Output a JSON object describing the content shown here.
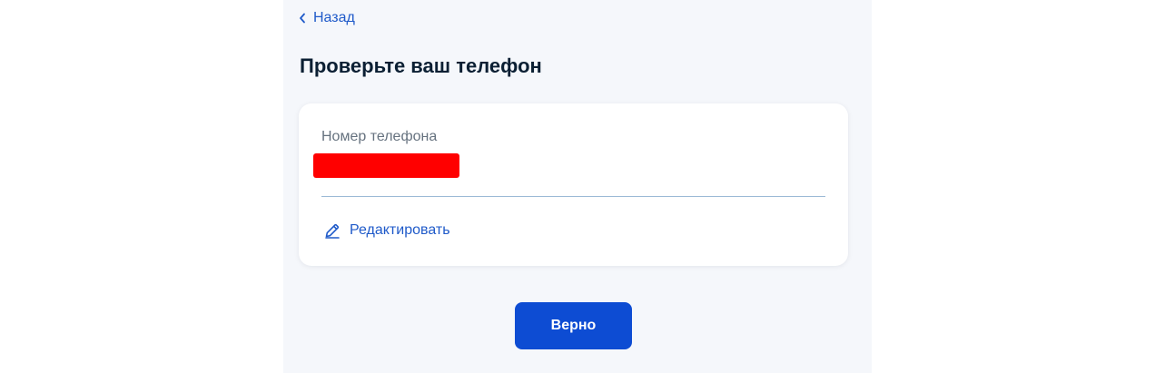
{
  "back_link": {
    "label": "Назад",
    "icon": "chevron-left-icon"
  },
  "page": {
    "title": "Проверьте ваш телефон"
  },
  "phone_card": {
    "field_label": "Номер телефона",
    "value_state": "redacted",
    "redaction_color": "#ff0000",
    "edit_label": "Редактировать",
    "edit_icon": "pencil-icon"
  },
  "actions": {
    "confirm_label": "Верно"
  },
  "colors": {
    "accent": "#0d4cd3",
    "link": "#1f5ac9",
    "title": "#0b1f33",
    "label": "#66727f",
    "page_background": "#f5f7fb"
  }
}
